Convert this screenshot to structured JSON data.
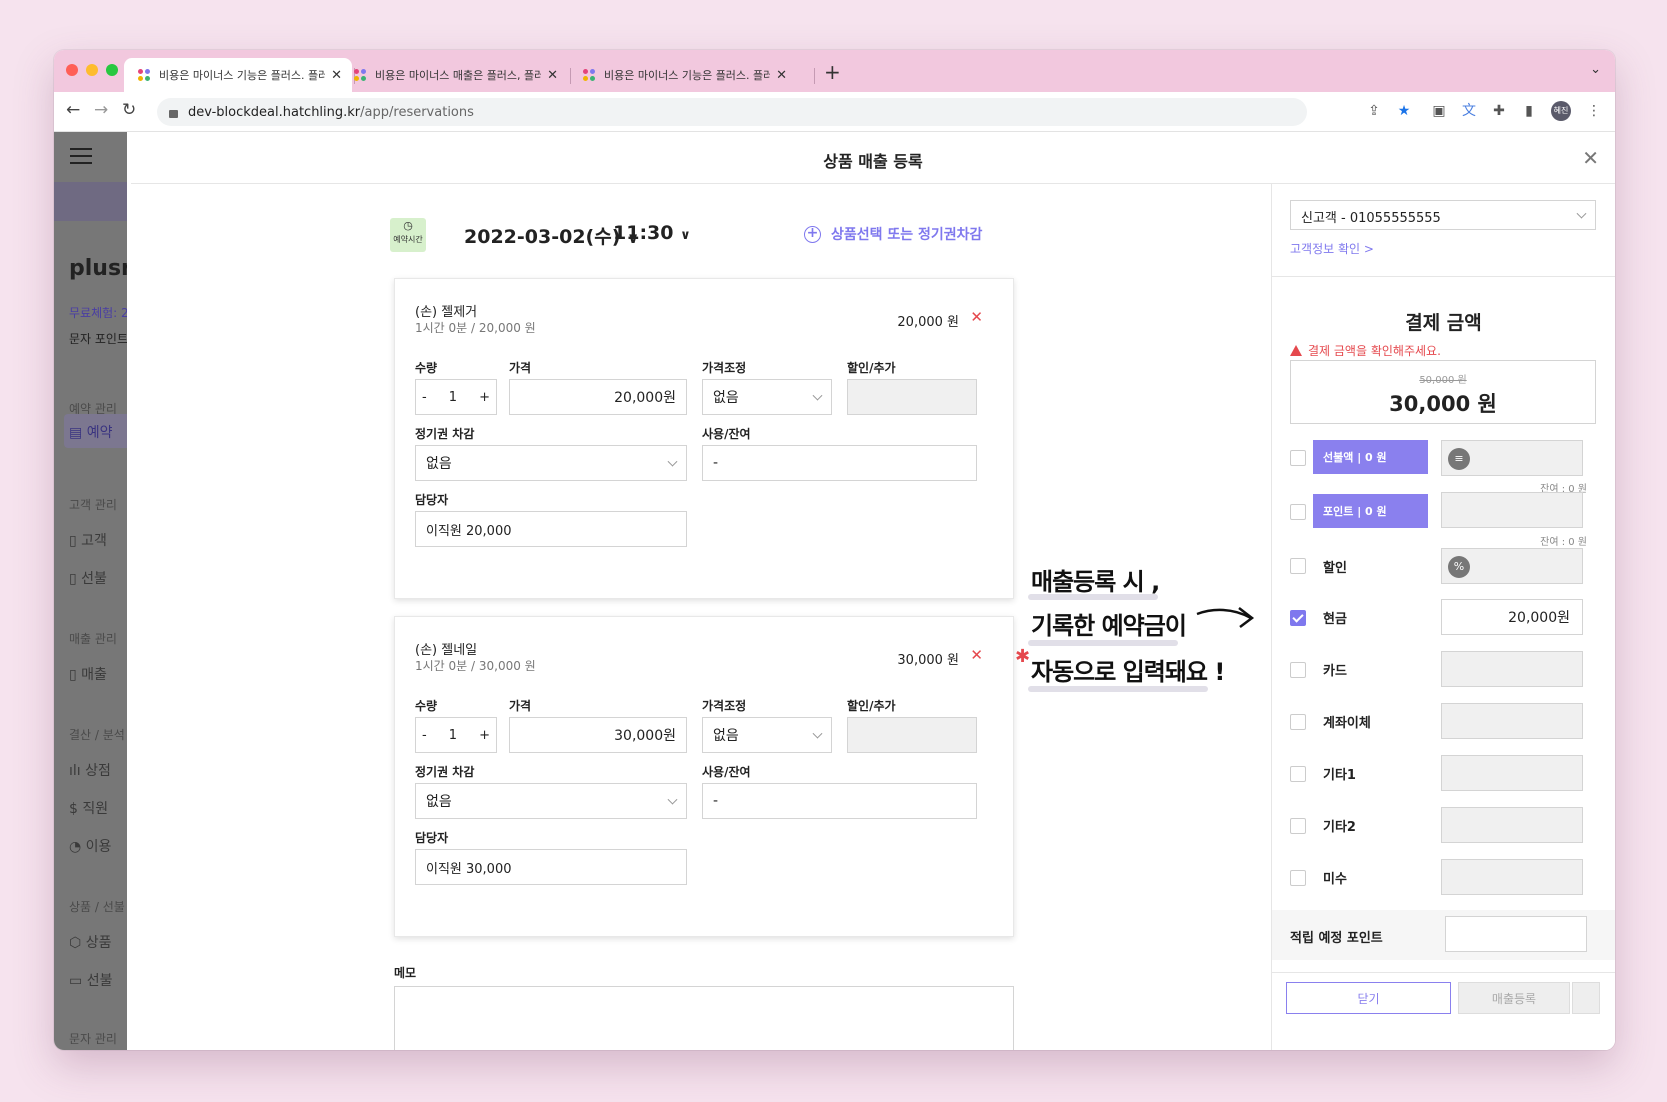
{
  "browser": {
    "tabs": [
      {
        "title": "비용은 마이너스 기능은 플러스. 플러스"
      },
      {
        "title": "비용은 마이너스 매출은 플러스, 플러스"
      },
      {
        "title": "비용은 마이너스 기능은 플러스. 플러스"
      }
    ],
    "url_host": "dev-blockdeal.hatchling.kr",
    "url_path": "/app/reservations",
    "profile": "혜진"
  },
  "sidebar": {
    "brand": "plusn",
    "trial": "무료체험: 2",
    "sms_points": "문자 포인트",
    "sections": [
      {
        "head": "예약 관리",
        "items": [
          "예약"
        ]
      },
      {
        "head": "고객 관리",
        "items": [
          "고객",
          "선불"
        ]
      },
      {
        "head": "매출 관리",
        "items": [
          "매출"
        ]
      },
      {
        "head": "결산 / 분석",
        "items": [
          "상점",
          "직원",
          "이용"
        ]
      },
      {
        "head": "상품 / 선불",
        "items": [
          "상품",
          "선불"
        ]
      },
      {
        "head": "문자 관리",
        "items": []
      }
    ]
  },
  "modal": {
    "title": "상품 매출 등록",
    "time_badge": "예약시간",
    "date": "2022-03-02(수)",
    "time": "11:30",
    "add_product": "상품선택 또는 정기권차감",
    "labels": {
      "quantity": "수량",
      "price": "가격",
      "price_adjust": "가격조정",
      "discount_add": "할인/추가",
      "pass_deduct": "정기권 차감",
      "usage_remaining": "사용/잔여",
      "staff": "담당자"
    },
    "products": [
      {
        "name": "(손) 젤제거",
        "sub": "1시간 0분 / 20,000 원",
        "total": "20,000 원",
        "quantity": "1",
        "price": "20,000원",
        "price_adjust": "없음",
        "pass": "없음",
        "usage": "-",
        "staff": "이직원 20,000"
      },
      {
        "name": "(손) 젤네일",
        "sub": "1시간 0분 / 30,000 원",
        "total": "30,000 원",
        "quantity": "1",
        "price": "30,000원",
        "price_adjust": "없음",
        "pass": "없음",
        "usage": "-",
        "staff": "이직원 30,000"
      }
    ],
    "memo_label": "메모"
  },
  "annotation": {
    "line1": "매출등록 시 ,",
    "line2": "기록한 예약금이",
    "line3": "자동으로 입력돼요 !"
  },
  "payment": {
    "customer": "신고객 - 01055555555",
    "customer_link": "고객정보 확인 >",
    "title": "결제 금액",
    "warning": "결제 금액을 확인해주세요.",
    "original": "50,000 원",
    "final": "30,000 원",
    "rows": [
      {
        "label": "선불액 | 0 원",
        "type": "purple",
        "checked": false,
        "value": "",
        "remain": "잔여 : 0 원"
      },
      {
        "label": "포인트 | 0 원",
        "type": "purple",
        "checked": false,
        "value": "",
        "remain": "잔여 : 0 원"
      },
      {
        "label": "할인",
        "type": "plain",
        "checked": false,
        "value": ""
      },
      {
        "label": "현금",
        "type": "plain",
        "checked": true,
        "value": "20,000원"
      },
      {
        "label": "카드",
        "type": "plain",
        "checked": false,
        "value": ""
      },
      {
        "label": "계좌이체",
        "type": "plain",
        "checked": false,
        "value": ""
      },
      {
        "label": "기타1",
        "type": "plain",
        "checked": false,
        "value": ""
      },
      {
        "label": "기타2",
        "type": "plain",
        "checked": false,
        "value": ""
      },
      {
        "label": "미수",
        "type": "plain",
        "checked": false,
        "value": ""
      }
    ],
    "earn_label": "적립 예정 포인트",
    "close_button": "닫기",
    "submit_button": "매출등록"
  },
  "colors": {
    "accent": "#7f78ee",
    "danger": "#e5484d",
    "tabstrip": "#f2c8de"
  }
}
